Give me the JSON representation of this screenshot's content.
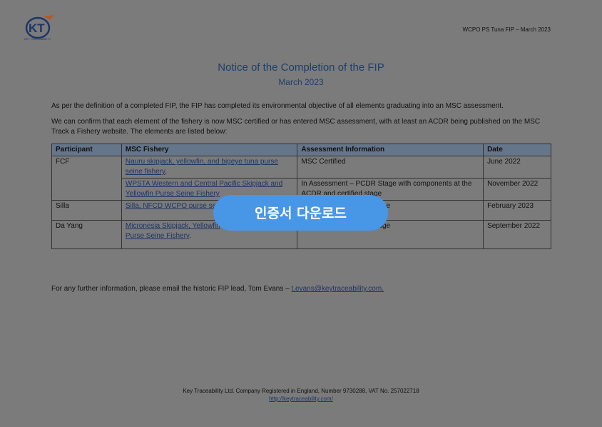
{
  "header": {
    "logo_text": "KT",
    "logo_subtext": "KEY TRACEABILITY",
    "doc_ref": "WCPO PS Tuna FIP – March 2023"
  },
  "document": {
    "title": "Notice of the Completion of the FIP",
    "subtitle": "March 2023",
    "paragraph_1": "As per the definition of a completed FIP, the FIP has completed its environmental objective of all elements graduating into an MSC assessment.",
    "paragraph_2": "We can confirm that each element of the fishery is now MSC certified or has entered MSC assessment, with at least an ACDR being published on the MSC Track a Fishery website. The elements are listed below:",
    "table": {
      "headers": [
        "Participant",
        "MSC Fishery",
        "Assessment Information",
        "Date"
      ],
      "rows": [
        {
          "participant": "FCF",
          "fishery": "Nauru skipjack, yellowfin, and bigeye tuna purse seine fishery",
          "fishery_suffix": ".",
          "assessment": "MSC Certified",
          "date": "June 2022"
        },
        {
          "participant": "",
          "fishery": "WPSTA Western and Central Pacific Skipjack and Yellowfin Purse Seine Fishery",
          "fishery_suffix": "",
          "assessment": "In Assessment – PCDR Stage with components at the ACDR and certified stage",
          "date": "November 2022"
        },
        {
          "participant": "Silla",
          "fishery": "Silla, NFCD WCPO purse seine",
          "fishery_suffix": "",
          "assessment": "e",
          "date": "February 2023"
        },
        {
          "participant": "Da Yang",
          "fishery": "Micronesia Skipjack, Yellowfin",
          "fishery_suffix": "",
          "fishery_line2": "Purse Seine Fishery",
          "fishery_line2_suffix": ".",
          "assessment": "age",
          "date": "September 2022"
        }
      ]
    },
    "contact_text": "For any further information, please email the historic FIP lead, Tom Evans – ",
    "contact_email": "t.evans@keytraceability.com."
  },
  "footer": {
    "company": "Key Traceability Ltd. Company Registered in England, Number 9730288, VAT No. 257022718",
    "url": "http://keytraceability.com/"
  },
  "overlay": {
    "download_label": "인증서 다운로드",
    "button_color": "#4896e6",
    "dim_color": "#7b7b7b"
  }
}
